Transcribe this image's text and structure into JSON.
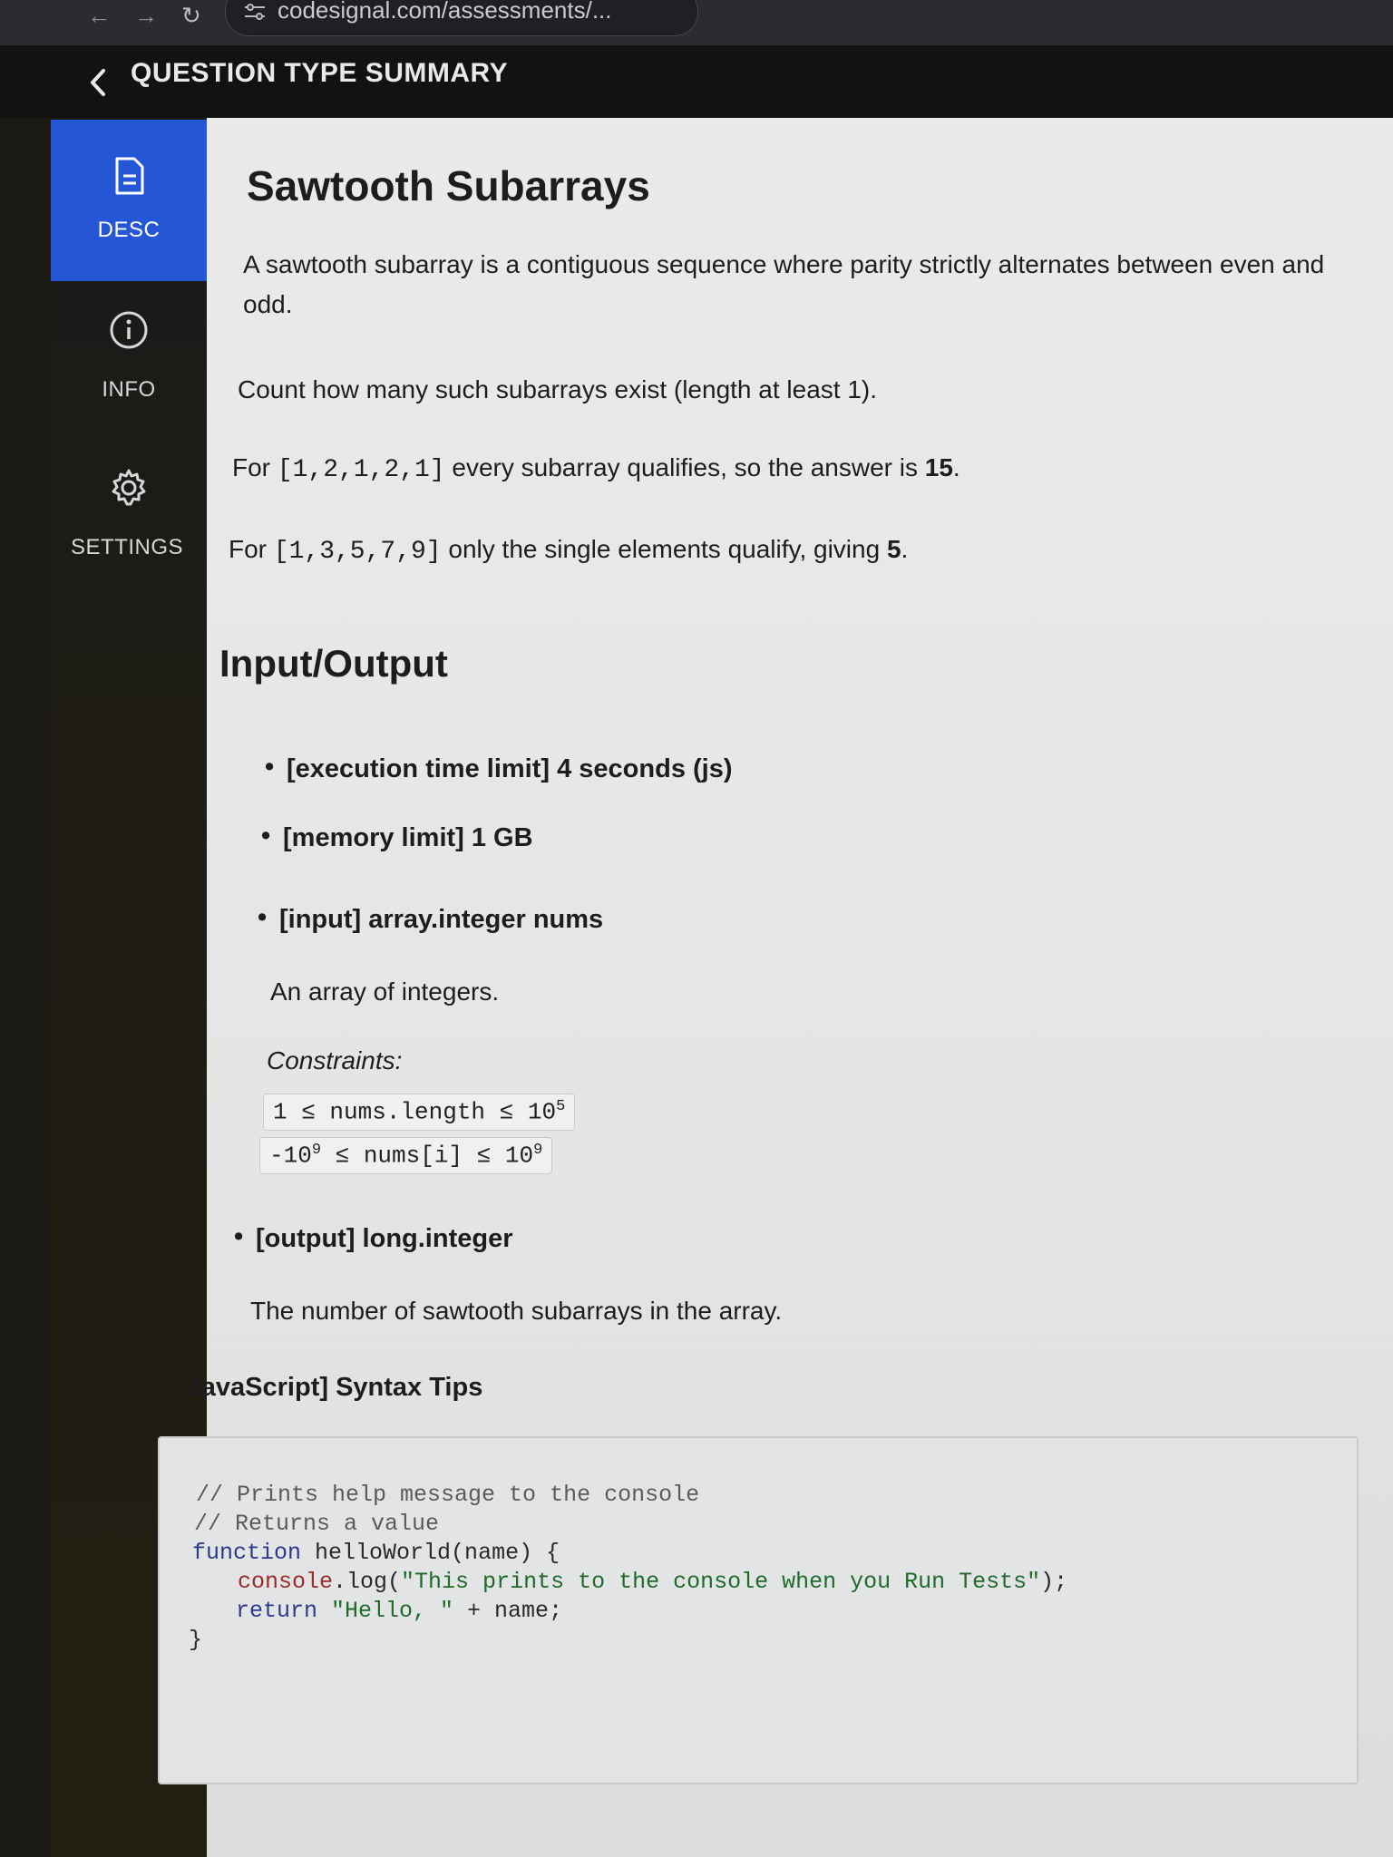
{
  "browser": {
    "url": "codesignal.com/assessments/..."
  },
  "header": {
    "title": "QUESTION TYPE SUMMARY"
  },
  "sidebar": {
    "items": [
      {
        "label": "DESC",
        "icon": "document-icon",
        "active": true
      },
      {
        "label": "INFO",
        "icon": "info-icon",
        "active": false
      },
      {
        "label": "SETTINGS",
        "icon": "gear-icon",
        "active": false
      }
    ]
  },
  "problem": {
    "title": "Sawtooth Subarrays",
    "intro": "A sawtooth subarray is a contiguous sequence where parity strictly alternates between even and odd.",
    "count_text": "Count how many such subarrays exist (length at least 1).",
    "example1": {
      "prefix": "For",
      "array": "[1,2,1,2,1]",
      "middle": "every subarray qualifies, so the answer is",
      "answer": "15",
      "suffix": "."
    },
    "example2": {
      "prefix": "For",
      "array": "[1,3,5,7,9]",
      "middle": "only the single elements qualify, giving",
      "answer": "5",
      "suffix": "."
    }
  },
  "io": {
    "heading": "Input/Output",
    "time_limit": "[execution time limit] 4 seconds (js)",
    "memory_limit": "[memory limit] 1 GB",
    "input_label": "[input] array.integer nums",
    "input_desc": "An array of integers.",
    "constraints_label": "Constraints:",
    "constraint1": {
      "left": "1 ≤ nums.length ≤ 10",
      "exp": "5"
    },
    "constraint2": {
      "pre": "-10",
      "exp1": "9",
      "mid": " ≤ nums[i] ≤ 10",
      "exp2": "9"
    },
    "output_label": "[output] long.integer",
    "output_desc": "The number of sawtooth subarrays in the array."
  },
  "syntax": {
    "heading": "[JavaScript] Syntax Tips",
    "lines": {
      "l1": "// Prints help message to the console",
      "l2": "// Returns a value",
      "l3_kw": "function",
      "l3_rest": " helloWorld(name) {",
      "l4_obj": "console",
      "l4_fn": ".log(",
      "l4_str": "\"This prints to the console when you Run Tests\"",
      "l4_end": ");",
      "l5_kw": "return",
      "l5_str": " \"Hello, \"",
      "l5_rest": " + name;",
      "l6": "}"
    }
  },
  "colors": {
    "sidebar_active": "#2456d6",
    "header_bg": "#121212",
    "content_bg": "#e9eaea"
  }
}
